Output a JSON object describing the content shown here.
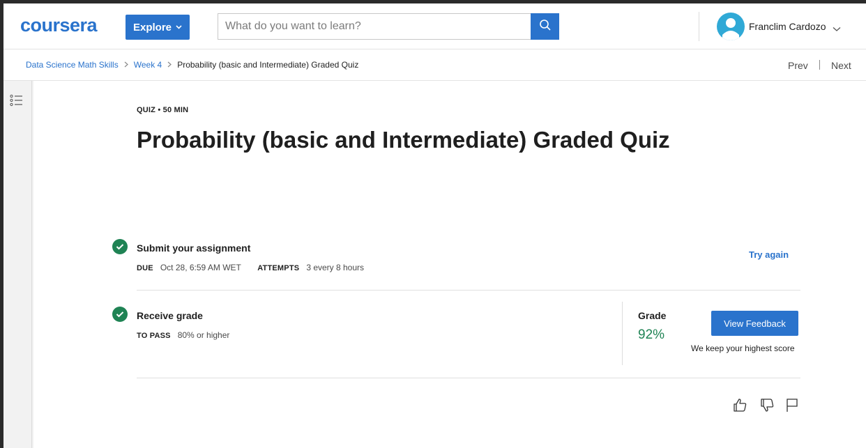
{
  "header": {
    "logo": "coursera",
    "explore_label": "Explore",
    "search_placeholder": "What do you want to learn?",
    "user_name": "Franclim Cardozo"
  },
  "breadcrumb": {
    "items": [
      "Data Science Math Skills",
      "Week 4"
    ],
    "current": "Probability (basic and Intermediate) Graded Quiz",
    "prev_label": "Prev",
    "next_label": "Next"
  },
  "quiz": {
    "meta": "QUIZ • 50 MIN",
    "title": "Probability (basic and Intermediate) Graded Quiz"
  },
  "submit": {
    "title": "Submit your assignment",
    "due_label": "DUE",
    "due_value": "Oct 28, 6:59 AM WET",
    "attempts_label": "ATTEMPTS",
    "attempts_value": "3 every 8 hours",
    "try_again": "Try again"
  },
  "receive": {
    "title": "Receive grade",
    "pass_label": "TO PASS",
    "pass_value": "80% or higher",
    "grade_label": "Grade",
    "grade_value": "92%",
    "feedback_button": "View Feedback",
    "highest_note": "We keep your highest score"
  },
  "icons": [
    "search-icon",
    "user-avatar-icon",
    "chevron-down-icon",
    "list-icon",
    "check-icon",
    "thumbs-up-icon",
    "thumbs-down-icon",
    "flag-icon"
  ],
  "colors": {
    "brand": "#2a73cc",
    "success": "#1f8354"
  }
}
